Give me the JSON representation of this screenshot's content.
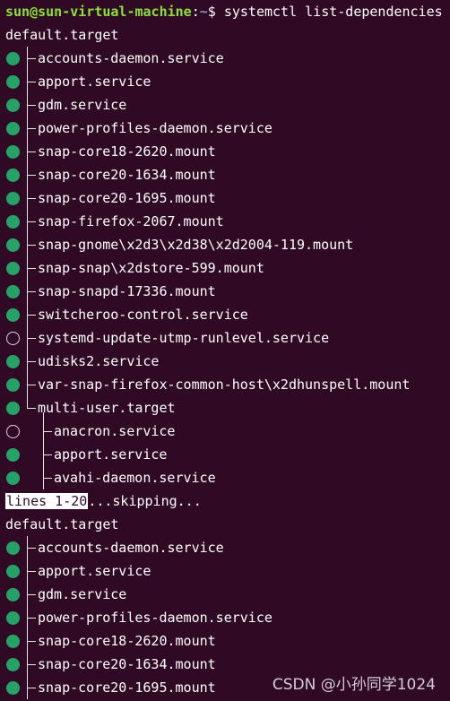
{
  "prompt": {
    "user_host": "sun@sun-virtual-machine",
    "separator": ":",
    "path": "~",
    "symbol": "$ ",
    "command": "systemctl list-dependencies"
  },
  "block1": {
    "root": "default.target",
    "items": [
      {
        "label": "accounts-daemon.service",
        "state": "active"
      },
      {
        "label": "apport.service",
        "state": "active"
      },
      {
        "label": "gdm.service",
        "state": "active"
      },
      {
        "label": "power-profiles-daemon.service",
        "state": "active"
      },
      {
        "label": "snap-core18-2620.mount",
        "state": "active"
      },
      {
        "label": "snap-core20-1634.mount",
        "state": "active"
      },
      {
        "label": "snap-core20-1695.mount",
        "state": "active"
      },
      {
        "label": "snap-firefox-2067.mount",
        "state": "active"
      },
      {
        "label": "snap-gnome\\x2d3\\x2d38\\x2d2004-119.mount",
        "state": "active"
      },
      {
        "label": "snap-snap\\x2dstore-599.mount",
        "state": "active"
      },
      {
        "label": "snap-snapd-17336.mount",
        "state": "active"
      },
      {
        "label": "switcheroo-control.service",
        "state": "active"
      },
      {
        "label": "systemd-update-utmp-runlevel.service",
        "state": "inactive"
      },
      {
        "label": "udisks2.service",
        "state": "active"
      },
      {
        "label": "var-snap-firefox-common-host\\x2dhunspell.mount",
        "state": "active"
      },
      {
        "label": "multi-user.target",
        "state": "active"
      }
    ],
    "children": [
      {
        "label": "anacron.service",
        "state": "inactive"
      },
      {
        "label": "apport.service",
        "state": "active"
      },
      {
        "label": "avahi-daemon.service",
        "state": "active"
      }
    ]
  },
  "pager": {
    "indicator": "lines 1-20",
    "message": "...skipping..."
  },
  "block2": {
    "root": "default.target",
    "items": [
      {
        "label": "accounts-daemon.service",
        "state": "active"
      },
      {
        "label": "apport.service",
        "state": "active"
      },
      {
        "label": "gdm.service",
        "state": "active"
      },
      {
        "label": "power-profiles-daemon.service",
        "state": "active"
      },
      {
        "label": "snap-core18-2620.mount",
        "state": "active"
      },
      {
        "label": "snap-core20-1634.mount",
        "state": "active"
      },
      {
        "label": "snap-core20-1695.mount",
        "state": "active"
      }
    ]
  },
  "watermark": "CSDN @小孙同学1024",
  "colors": {
    "background": "#300a24",
    "active_dot": "#26a269",
    "prompt_user": "#8ae234",
    "prompt_path": "#729fcf"
  }
}
